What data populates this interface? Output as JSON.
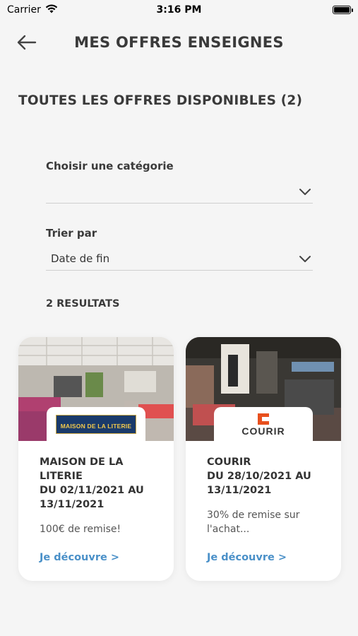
{
  "status": {
    "carrier": "Carrier",
    "time": "3:16 PM"
  },
  "header": {
    "title": "MES OFFRES ENSEIGNES"
  },
  "section": {
    "title": "TOUTES LES OFFRES DISPONIBLES (2)"
  },
  "filters": {
    "category": {
      "label": "Choisir une catégorie",
      "value": ""
    },
    "sort": {
      "label": "Trier par",
      "value": "Date de fin"
    }
  },
  "results": {
    "label": "2 RESULTATS"
  },
  "offers": [
    {
      "brand": "MAISON DE LA LITERIE",
      "logo_text": "MAISON DE LA LITERIE",
      "title_line1": "MAISON DE LA",
      "title_line2": "LITERIE",
      "title_line3": "DU 02/11/2021 AU",
      "title_line4": "13/11/2021",
      "description": "100€ de remise!",
      "cta": "Je découvre >"
    },
    {
      "brand": "COURIR",
      "logo_text": "COURIR",
      "title_line1": "COURIR",
      "title_line2": "DU 28/10/2021 AU",
      "title_line3": "13/11/2021",
      "description": "30% de remise sur l'achat...",
      "cta": "Je découvre >"
    }
  ],
  "colors": {
    "link": "#4a90c8",
    "courir_orange": "#e8501e",
    "background": "#f5f5f5"
  }
}
